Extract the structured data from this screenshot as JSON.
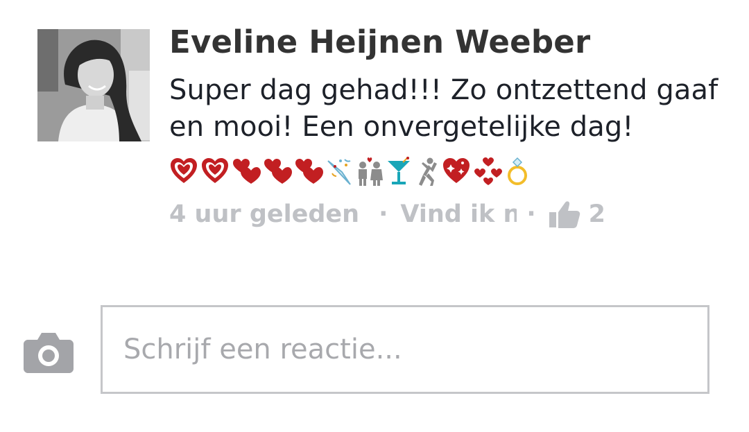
{
  "comment": {
    "author": "Eveline Heijnen Weeber",
    "text_line_1": "Super dag gehad!!! Zo ontzettend gaaf",
    "text_line_2": "en mooi! Een onvergetelijke dag!",
    "emojis": [
      "red-heart-ring-icon",
      "red-heart-ring-icon",
      "two-hearts-icon",
      "two-hearts-icon",
      "two-hearts-icon",
      "party-popper-icon",
      "couple-icon",
      "cocktail-icon",
      "dancer-icon",
      "sparkling-heart-icon",
      "revolving-hearts-icon",
      "ring-icon"
    ],
    "timestamp": "4 uur geleden",
    "separator": "·",
    "like_label": "Vind ik ni",
    "like_count": "2"
  },
  "composer": {
    "placeholder": "Schrijf een reactie...",
    "camera_icon": "camera-icon"
  },
  "colors": {
    "heart_red": "#c21f22",
    "meta_gray": "#bfc1c5",
    "cocktail_teal": "#19a6b8",
    "ring_gold": "#f3bd2a"
  }
}
